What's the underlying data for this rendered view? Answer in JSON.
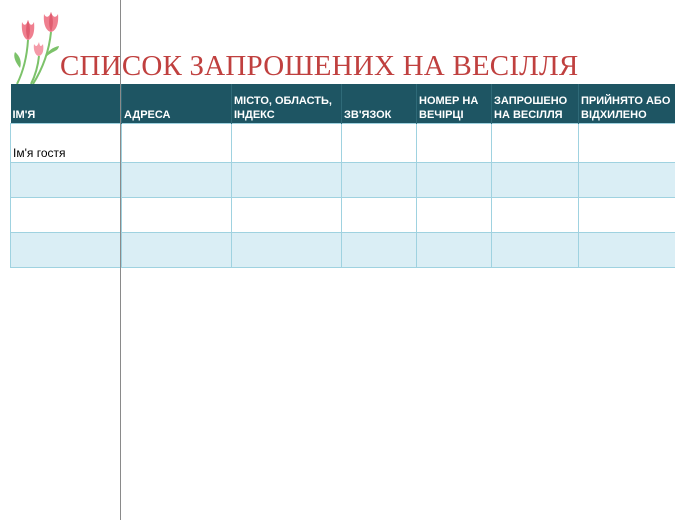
{
  "title": "СПИСОК ЗАПРОШЕНИХ НА ВЕСІЛЛЯ",
  "decoration": {
    "icon": "tulip-flowers-icon",
    "petal_color": "#ef7f8f",
    "leaf_color": "#7cc26a"
  },
  "colors": {
    "title": "#c0403f",
    "header_background": "#1e5563",
    "header_text": "#ffffff",
    "row_band": "#daeef5",
    "grid_lines": "#9fd2e0"
  },
  "table": {
    "columns": [
      {
        "label": "ІМ'Я"
      },
      {
        "label": "АДРЕСА"
      },
      {
        "label": "МІСТО, ОБЛАСТЬ, ІНДЕКС"
      },
      {
        "label": "ЗВ'ЯЗОК"
      },
      {
        "label": "НОМЕР НА ВЕЧІРЦІ"
      },
      {
        "label": "ЗАПРОШЕНО НА ВЕСІЛЛЯ"
      },
      {
        "label": "ПРИЙНЯТО АБО ВІДХИЛЕНО"
      }
    ],
    "rows": [
      [
        "Ім'я гостя",
        "",
        "",
        "",
        "",
        "",
        ""
      ],
      [
        "",
        "",
        "",
        "",
        "",
        "",
        ""
      ],
      [
        "",
        "",
        "",
        "",
        "",
        "",
        ""
      ],
      [
        "",
        "",
        "",
        "",
        "",
        "",
        ""
      ]
    ]
  }
}
